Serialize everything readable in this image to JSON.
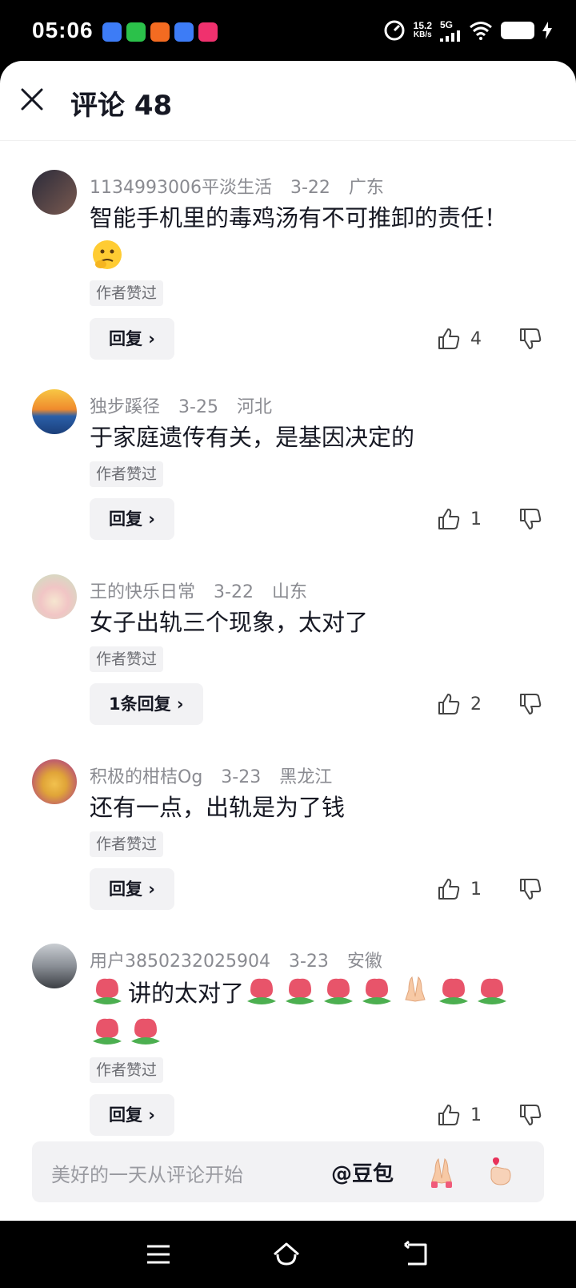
{
  "status_bar": {
    "time": "05:06",
    "speed_value": "15.2",
    "speed_unit": "KB/s",
    "network": "5G",
    "app_icons": [
      "baidu-icon",
      "wechat-icon",
      "orange-app-icon",
      "baidu-icon",
      "pink-app-icon"
    ]
  },
  "header": {
    "title": "评论 48",
    "close_icon": "close-icon"
  },
  "comments": [
    {
      "user": "1134993006平淡生活",
      "date": "3-22",
      "location": "广东",
      "text": "智能手机里的毒鸡汤有不可推卸的责任！",
      "tag": "作者赞过",
      "reply_label": "回复 ›",
      "likes": "4"
    },
    {
      "user": "独步蹊径",
      "date": "3-25",
      "location": "河北",
      "text": "于家庭遗传有关，是基因决定的",
      "tag": "作者赞过",
      "reply_label": "回复 ›",
      "likes": "1"
    },
    {
      "user": "王的快乐日常",
      "date": "3-22",
      "location": "山东",
      "text": "女子出轨三个现象，太对了",
      "tag": "作者赞过",
      "reply_label": "1条回复 ›",
      "likes": "2"
    },
    {
      "user": "积极的柑桔Og",
      "date": "3-23",
      "location": "黑龙江",
      "text": "还有一点，出轨是为了钱",
      "tag": "作者赞过",
      "reply_label": "回复 ›",
      "likes": "1"
    },
    {
      "user": "用户3850232025904",
      "date": "3-23",
      "location": "安徽",
      "text": "讲的太对了",
      "tag": "作者赞过",
      "reply_label": "回复 ›",
      "likes": "1"
    }
  ],
  "input_bar": {
    "placeholder": "美好的一天从评论开始",
    "mention": "@豆包"
  },
  "colors": {
    "text_primary": "#161823",
    "text_secondary": "#8a8b91",
    "chip_bg": "#f2f2f4",
    "tulip": "#e8546a",
    "leaf": "#4caf50"
  }
}
